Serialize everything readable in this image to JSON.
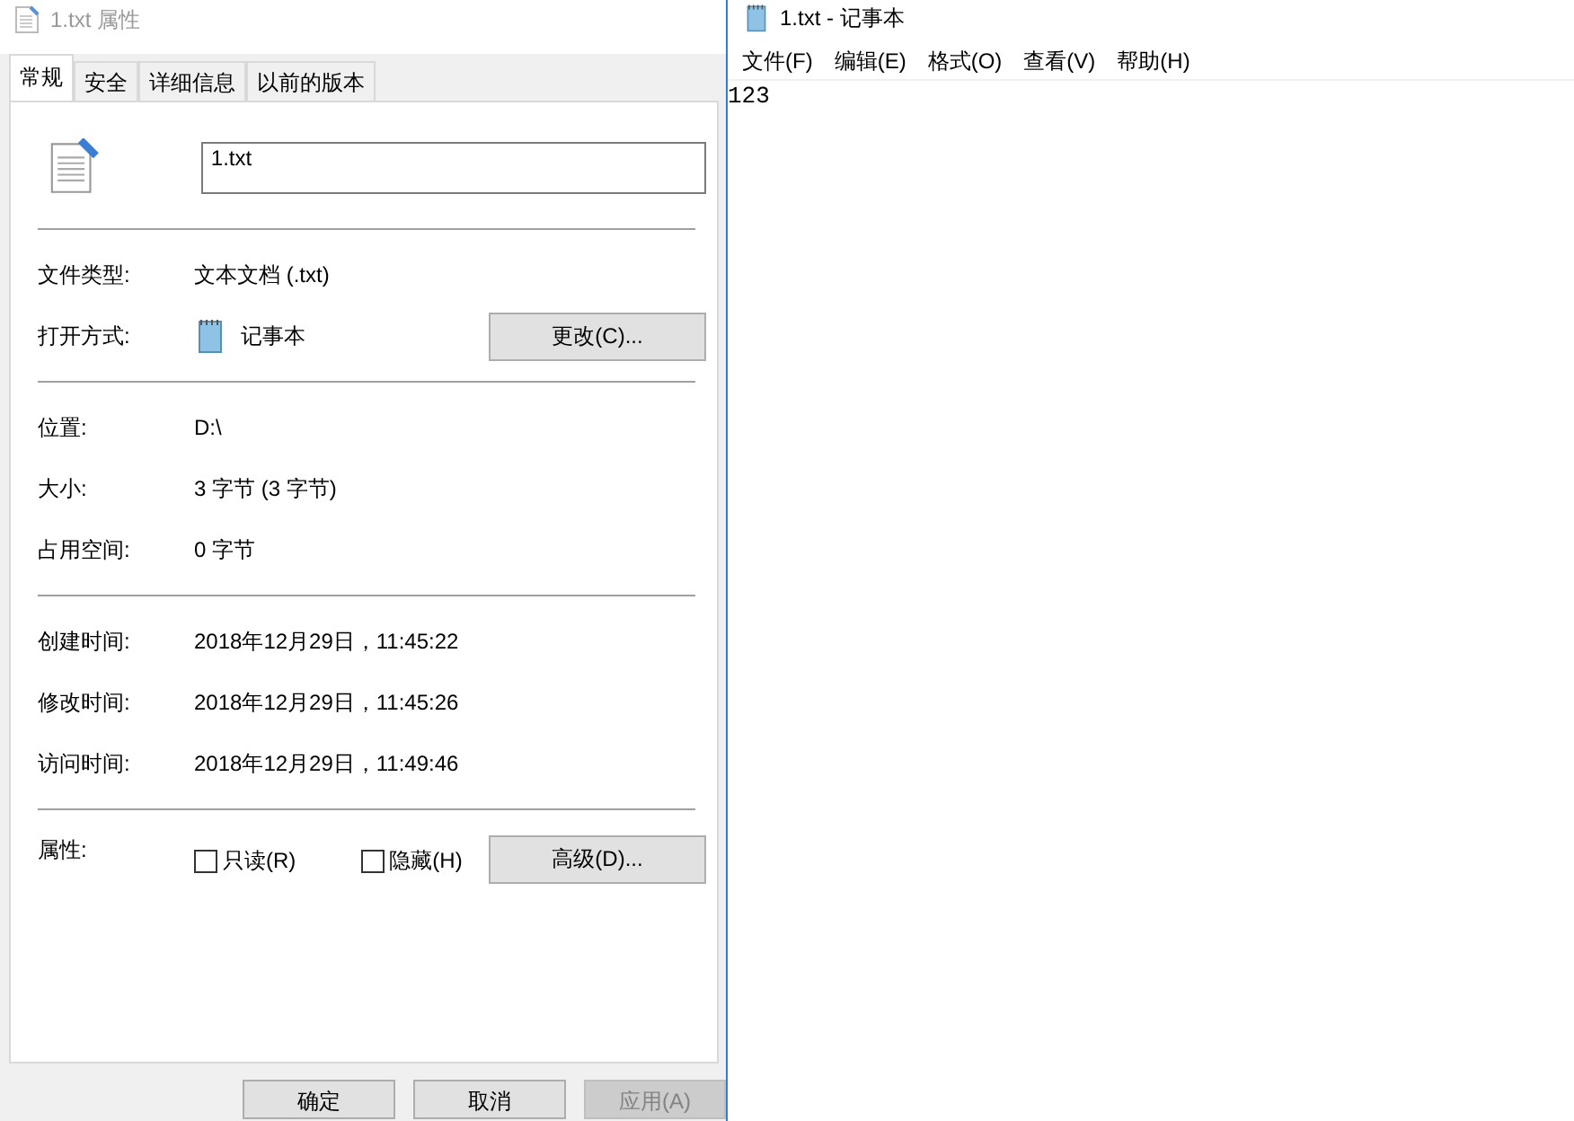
{
  "properties_dialog": {
    "title": "1.txt 属性",
    "tabs": [
      {
        "label": "常规",
        "selected": true
      },
      {
        "label": "安全",
        "selected": false
      },
      {
        "label": "详细信息",
        "selected": false
      },
      {
        "label": "以前的版本",
        "selected": false
      }
    ],
    "file_name": "1.txt",
    "sections": [
      [
        {
          "label": "文件类型:",
          "value": "文本文档 (.txt)"
        },
        {
          "label": "打开方式:",
          "value": "记事本",
          "app_icon": true,
          "button": "更改(C)..."
        }
      ],
      [
        {
          "label": "位置:",
          "value": "D:\\"
        },
        {
          "label": "大小:",
          "value": "3 字节 (3 字节)"
        },
        {
          "label": "占用空间:",
          "value": "0 字节"
        }
      ],
      [
        {
          "label": "创建时间:",
          "value": "2018年12月29日，11:45:22"
        },
        {
          "label": "修改时间:",
          "value": "2018年12月29日，11:45:26"
        },
        {
          "label": "访问时间:",
          "value": "2018年12月29日，11:49:46"
        }
      ]
    ],
    "attributes": {
      "label": "属性:",
      "checkboxes": [
        {
          "label": "只读(R)",
          "checked": false
        },
        {
          "label": "隐藏(H)",
          "checked": false
        }
      ],
      "button": "高级(D)..."
    },
    "buttons": [
      {
        "label": "确定",
        "disabled": false
      },
      {
        "label": "取消",
        "disabled": false
      },
      {
        "label": "应用(A)",
        "disabled": true
      }
    ]
  },
  "notepad": {
    "title": "1.txt - 记事本",
    "menu": [
      "文件(F)",
      "编辑(E)",
      "格式(O)",
      "查看(V)",
      "帮助(H)"
    ],
    "content": "123"
  }
}
